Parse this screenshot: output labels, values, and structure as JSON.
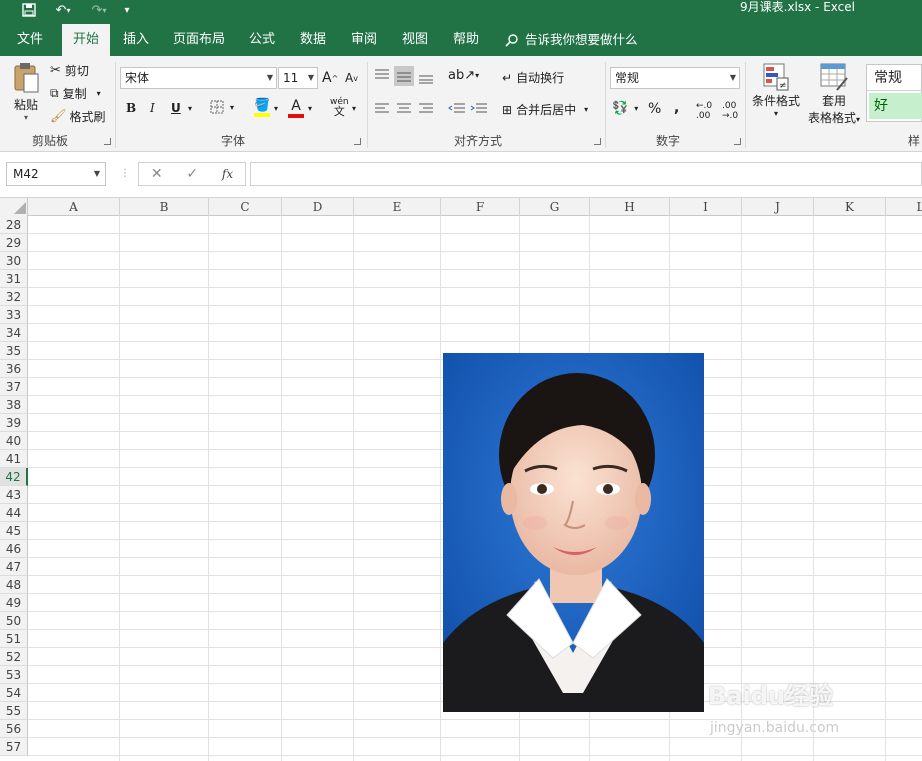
{
  "window": {
    "title": "9月课表.xlsx  -  Excel"
  },
  "tabs": [
    {
      "label": "文件"
    },
    {
      "label": "开始"
    },
    {
      "label": "插入"
    },
    {
      "label": "页面布局"
    },
    {
      "label": "公式"
    },
    {
      "label": "数据"
    },
    {
      "label": "审阅"
    },
    {
      "label": "视图"
    },
    {
      "label": "帮助"
    }
  ],
  "tell_me": "告诉我你想要做什么",
  "clipboard": {
    "paste": "粘贴",
    "cut": "剪切",
    "copy": "复制",
    "format_painter": "格式刷",
    "group": "剪贴板"
  },
  "font": {
    "name": "宋体",
    "size": "11",
    "bold": "B",
    "italic": "I",
    "underline": "U",
    "font_color_letter": "A",
    "phonetic": "wén",
    "group": "字体"
  },
  "alignment": {
    "wrap": "自动换行",
    "merge": "合并后居中",
    "group": "对齐方式"
  },
  "number": {
    "format": "常规",
    "percent": "%",
    "comma": ",",
    "group": "数字"
  },
  "styles": {
    "conditional": "条件格式",
    "table_format_1": "套用",
    "table_format_2": "表格格式",
    "style_normal": "常规",
    "style_good": "好",
    "group": "样"
  },
  "formula_bar": {
    "name_box": "M42",
    "fx": "fx",
    "value": ""
  },
  "columns": [
    "A",
    "B",
    "C",
    "D",
    "E",
    "F",
    "G",
    "H",
    "I",
    "J",
    "K",
    "L"
  ],
  "rows": [
    "28",
    "29",
    "30",
    "31",
    "32",
    "33",
    "34",
    "35",
    "36",
    "37",
    "38",
    "39",
    "40",
    "41",
    "42",
    "43",
    "44",
    "45",
    "46",
    "47",
    "48",
    "49",
    "50",
    "51",
    "52",
    "53",
    "54",
    "55",
    "56",
    "57"
  ],
  "selected_row": "42",
  "watermark": {
    "brand": "Baidu经验",
    "url": "jingyan.baidu.com"
  },
  "colors": {
    "excel_green": "#217346",
    "photo_background": "#1a5fb8"
  }
}
